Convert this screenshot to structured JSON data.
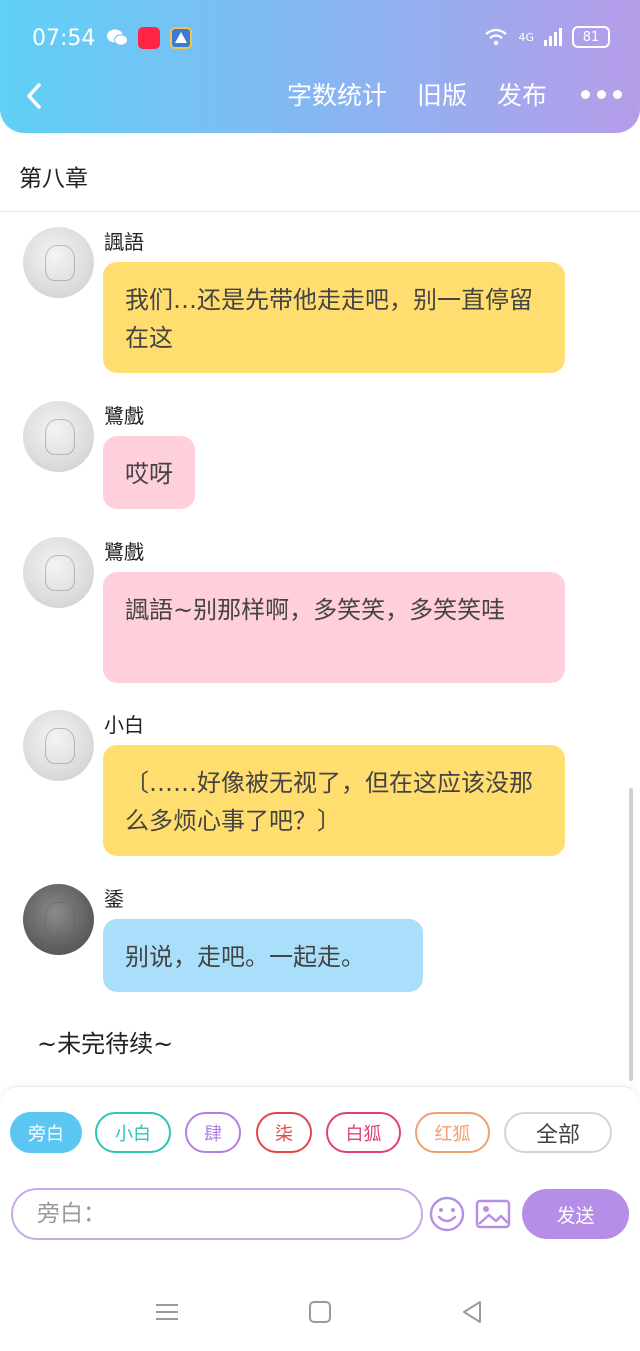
{
  "status_bar": {
    "time": "07:54",
    "network": "4G",
    "battery": "81",
    "app_icons": [
      "wechat-icon",
      "xiaohongshu-icon",
      "game-app-icon"
    ]
  },
  "toolbar": {
    "actions": [
      "字数统计",
      "旧版",
      "发布"
    ],
    "back_icon": "chevron-left-icon",
    "more_icon": "more-dots-icon"
  },
  "chapter": {
    "title": "第八章"
  },
  "messages": [
    {
      "sender": "諷語",
      "text": "我们…还是先带他走走吧，别一直停留在这",
      "color": "#ffdd6e"
    },
    {
      "sender": "鷺戲",
      "text": "哎呀",
      "color": "#ffcfdc"
    },
    {
      "sender": "鷺戲",
      "text": "諷語~别那样啊，多笑笑，多笑笑哇",
      "color": "#ffcfdc"
    },
    {
      "sender": "小白",
      "text": "〔……好像被无视了，但在这应该没那么多烦心事了吧？〕",
      "color": "#ffdd6e"
    },
    {
      "sender": "鋈",
      "text": "别说，走吧。一起走。",
      "color": "#a9dffa"
    }
  ],
  "footer_text": "~未完待续~",
  "roles": [
    {
      "label": "旁白",
      "color": "#5cc6f2",
      "active": true
    },
    {
      "label": "小白",
      "color": "#2ec4b6",
      "active": false
    },
    {
      "label": "肆",
      "color": "#b47fe0",
      "active": false
    },
    {
      "label": "柒",
      "color": "#e04848",
      "active": false
    },
    {
      "label": "白狐",
      "color": "#e0407a",
      "active": false
    },
    {
      "label": "红狐",
      "color": "#f0a070",
      "active": false
    },
    {
      "label": "全部",
      "color": "#cccccc",
      "active": false
    }
  ],
  "input": {
    "placeholder": "旁白：",
    "emoji_icon": "smiley-icon",
    "image_icon": "image-icon"
  },
  "send_button": "发送",
  "navbar": {
    "icons": [
      "menu-icon",
      "home-icon",
      "back-triangle-icon"
    ]
  },
  "colors": {
    "accent": "#b78ee7",
    "header_gradient": [
      "#5fd0f6",
      "#b69ce9"
    ]
  }
}
